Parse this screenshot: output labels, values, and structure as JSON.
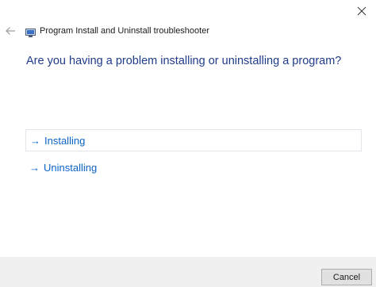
{
  "window": {
    "title": "Program Install and Uninstall troubleshooter"
  },
  "main": {
    "question": "Are you having a problem installing or uninstalling a program?",
    "options": [
      {
        "label": "Installing",
        "icon": "arrow-right-icon"
      },
      {
        "label": "Uninstalling",
        "icon": "arrow-right-icon"
      }
    ]
  },
  "footer": {
    "cancel_label": "Cancel"
  },
  "colors": {
    "question": "#1f3b8a",
    "link": "#0a64c8",
    "footer_bg": "#f0f0f0"
  }
}
